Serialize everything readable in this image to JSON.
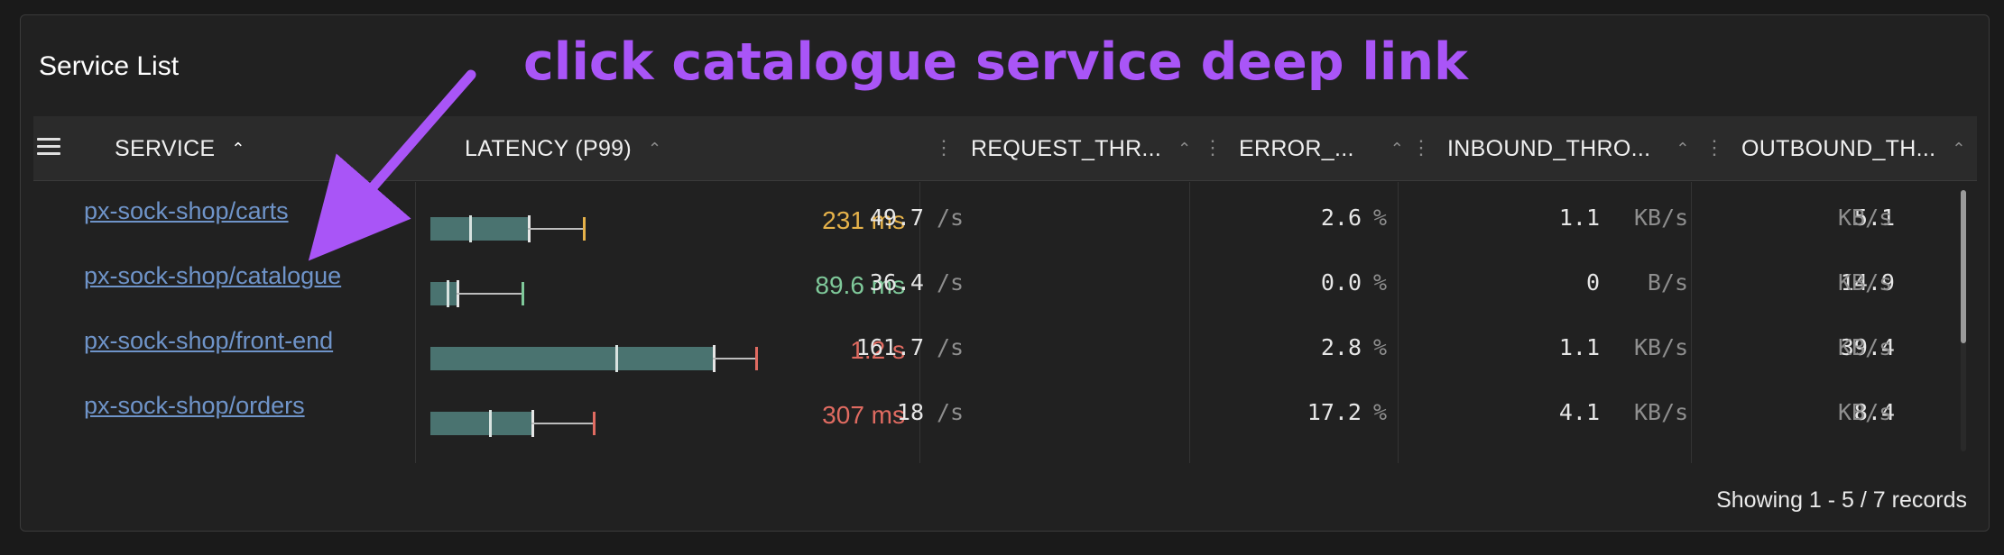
{
  "panel": {
    "title": "Service List",
    "annotation": "click catalogue service deep link",
    "footer": "Showing 1 - 5 / 7 records"
  },
  "colors": {
    "background": "#1a1a1a",
    "panel": "#212121",
    "link": "#6f94c9",
    "annotation": "#a955f7",
    "latency_warn": "#e6b24a",
    "latency_ok": "#7fc99a",
    "latency_bad": "#e06b61",
    "bar_fill": "#4a7370"
  },
  "table": {
    "columns": [
      {
        "label": "SERVICE",
        "sort_icon": "chevron-up-icon"
      },
      {
        "label": "LATENCY (P99)",
        "sort_icon": "chevron-up-icon"
      },
      {
        "label": "REQUEST_THR...",
        "sort_icon": "chevron-up-icon"
      },
      {
        "label": "ERROR_...",
        "sort_icon": "chevron-up-icon"
      },
      {
        "label": "INBOUND_THRO...",
        "sort_icon": "chevron-up-icon"
      },
      {
        "label": "OUTBOUND_TH...",
        "sort_icon": "chevron-up-icon"
      }
    ],
    "rows": [
      {
        "service": "px-sock-shop/carts",
        "latency": "231 ms",
        "latency_status": "warn",
        "latency_fractions": {
          "p50": 0.12,
          "p90": 0.3,
          "p99": 0.47
        },
        "request_value": "49.7",
        "request_unit": "/s",
        "error_value": "2.6",
        "error_unit": "%",
        "inbound_value": "1.1",
        "inbound_unit": "KB/s",
        "outbound_value": "5.1",
        "outbound_unit": "KB/s"
      },
      {
        "service": "px-sock-shop/catalogue",
        "latency": "89.6 ms",
        "latency_status": "ok",
        "latency_fractions": {
          "p50": 0.05,
          "p90": 0.08,
          "p99": 0.28
        },
        "request_value": "36.4",
        "request_unit": "/s",
        "error_value": "0.0",
        "error_unit": "%",
        "inbound_value": "0",
        "inbound_unit": "B/s",
        "outbound_value": "14.9",
        "outbound_unit": "KB/s"
      },
      {
        "service": "px-sock-shop/front-end",
        "latency": "1.2  s",
        "latency_status": "bad",
        "latency_fractions": {
          "p50": 0.57,
          "p90": 0.87,
          "p99": 1.0
        },
        "request_value": "161.7",
        "request_unit": "/s",
        "error_value": "2.8",
        "error_unit": "%",
        "inbound_value": "1.1",
        "inbound_unit": "KB/s",
        "outbound_value": "39.4",
        "outbound_unit": "KB/s"
      },
      {
        "service": "px-sock-shop/orders",
        "latency": "307 ms",
        "latency_status": "bad",
        "latency_fractions": {
          "p50": 0.18,
          "p90": 0.31,
          "p99": 0.5
        },
        "request_value": "18",
        "request_unit": "/s",
        "error_value": "17.2",
        "error_unit": "%",
        "inbound_value": "4.1",
        "inbound_unit": "KB/s",
        "outbound_value": "8.4",
        "outbound_unit": "KB/s"
      }
    ]
  }
}
